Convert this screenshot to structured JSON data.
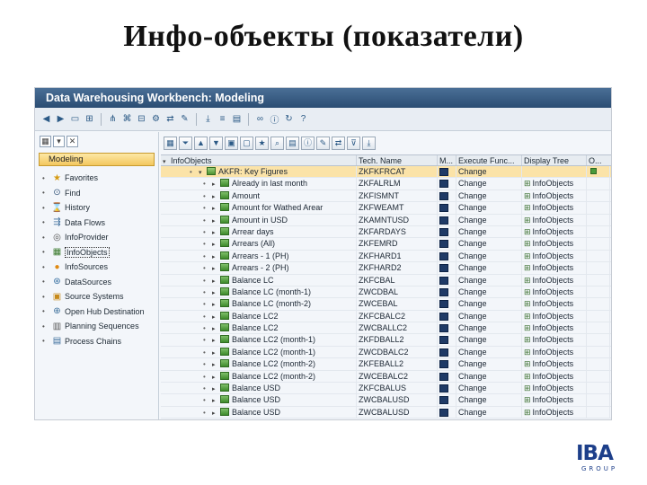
{
  "slide": {
    "title": "Инфо-объекты (показатели)"
  },
  "window": {
    "title": "Data Warehousing Workbench: Modeling"
  },
  "left_panel": {
    "tab_label": "Modeling",
    "items": [
      {
        "label": "Favorites",
        "icon": "star-icon"
      },
      {
        "label": "Find",
        "icon": "binoculars-icon"
      },
      {
        "label": "History",
        "icon": "history-icon"
      },
      {
        "label": "Data Flows",
        "icon": "data-flow-icon"
      },
      {
        "label": "InfoProvider",
        "icon": "infoprovider-icon"
      },
      {
        "label": "InfoObjects",
        "icon": "infoobjects-icon",
        "selected": true
      },
      {
        "label": "InfoSources",
        "icon": "infosources-icon"
      },
      {
        "label": "DataSources",
        "icon": "datasources-icon"
      },
      {
        "label": "Source Systems",
        "icon": "source-systems-icon"
      },
      {
        "label": "Open Hub Destination",
        "icon": "open-hub-icon"
      },
      {
        "label": "Planning Sequences",
        "icon": "planning-icon"
      },
      {
        "label": "Process Chains",
        "icon": "process-chains-icon"
      }
    ]
  },
  "grid": {
    "headers": {
      "name": "InfoObjects",
      "tech": "Tech. Name",
      "m": "M...",
      "exec": "Execute Func...",
      "tree": "Display Tree",
      "o": "O..."
    },
    "rows": [
      {
        "name": "AKFR: Key Figures",
        "tech": "ZKFKFRCAT",
        "exec": "Change",
        "tree": "",
        "highlight": true,
        "level": 0
      },
      {
        "name": "Already in last month",
        "tech": "ZKFALRLM",
        "exec": "Change",
        "tree": "InfoObjects"
      },
      {
        "name": "Amount",
        "tech": "ZKFISMNT",
        "exec": "Change",
        "tree": "InfoObjects"
      },
      {
        "name": "Amount for Wathed Arear",
        "tech": "ZKFWEAMT",
        "exec": "Change",
        "tree": "InfoObjects"
      },
      {
        "name": "Amount in USD",
        "tech": "ZKAMNTUSD",
        "exec": "Change",
        "tree": "InfoObjects"
      },
      {
        "name": "Arrear days",
        "tech": "ZKFARDAYS",
        "exec": "Change",
        "tree": "InfoObjects"
      },
      {
        "name": "Arrears (All)",
        "tech": "ZKFEMRD",
        "exec": "Change",
        "tree": "InfoObjects"
      },
      {
        "name": "Arrears - 1 (PH)",
        "tech": "ZKFHARD1",
        "exec": "Change",
        "tree": "InfoObjects"
      },
      {
        "name": "Arrears - 2 (PH)",
        "tech": "ZKFHARD2",
        "exec": "Change",
        "tree": "InfoObjects"
      },
      {
        "name": "Balance LC",
        "tech": "ZKFCBAL",
        "exec": "Change",
        "tree": "InfoObjects"
      },
      {
        "name": "Balance LC (month-1)",
        "tech": "ZWCDBAL",
        "exec": "Change",
        "tree": "InfoObjects"
      },
      {
        "name": "Balance LC (month-2)",
        "tech": "ZWCEBAL",
        "exec": "Change",
        "tree": "InfoObjects"
      },
      {
        "name": "Balance LC2",
        "tech": "ZKFCBALC2",
        "exec": "Change",
        "tree": "InfoObjects"
      },
      {
        "name": "Balance LC2",
        "tech": "ZWCBALLC2",
        "exec": "Change",
        "tree": "InfoObjects"
      },
      {
        "name": "Balance LC2 (month-1)",
        "tech": "ZKFDBALL2",
        "exec": "Change",
        "tree": "InfoObjects"
      },
      {
        "name": "Balance LC2 (month-1)",
        "tech": "ZWCDBALC2",
        "exec": "Change",
        "tree": "InfoObjects"
      },
      {
        "name": "Balance LC2 (month-2)",
        "tech": "ZKFEBALL2",
        "exec": "Change",
        "tree": "InfoObjects"
      },
      {
        "name": "Balance LC2 (month-2)",
        "tech": "ZWCEBALC2",
        "exec": "Change",
        "tree": "InfoObjects"
      },
      {
        "name": "Balance USD",
        "tech": "ZKFCBALUS",
        "exec": "Change",
        "tree": "InfoObjects"
      },
      {
        "name": "Balance USD",
        "tech": "ZWCBALUSD",
        "exec": "Change",
        "tree": "InfoObjects"
      },
      {
        "name": "Balance USD",
        "tech": "ZWCBALUSD",
        "exec": "Change",
        "tree": "InfoObjects"
      }
    ]
  },
  "logo": {
    "text": "IBA",
    "sub": "GROUP"
  }
}
